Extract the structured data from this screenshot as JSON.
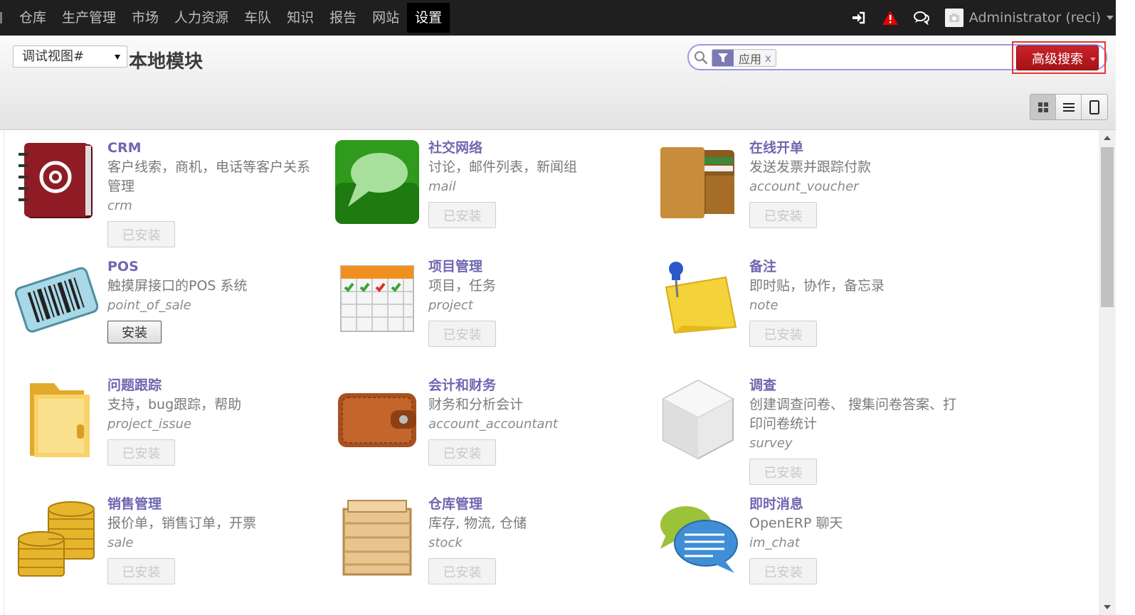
{
  "topmenu": [
    "仓库",
    "生产管理",
    "市场",
    "人力资源",
    "车队",
    "知识",
    "报告",
    "网站",
    "设置"
  ],
  "active_menu": "设置",
  "user": {
    "name": "Administrator (reci)"
  },
  "header": {
    "view_select": "调试视图#",
    "title": "本地模块",
    "facet_label": "应用",
    "facet_remove": "x",
    "search_value": "",
    "advanced_search": "高级搜索"
  },
  "view_modes": [
    "kanban-icon",
    "list-icon",
    "form-icon"
  ],
  "modules": [
    {
      "name": "CRM",
      "desc": "客户线索，商机，电话等客户关系管理",
      "tech": "crm",
      "button": "已安装",
      "installed": true,
      "icon": "address-book-icon"
    },
    {
      "name": "社交网络",
      "desc": "讨论，邮件列表，新闻组",
      "tech": "mail",
      "button": "已安装",
      "installed": true,
      "icon": "speech-bubble-icon"
    },
    {
      "name": "在线开单",
      "desc": "发送发票并跟踪付款",
      "tech": "account_voucher",
      "button": "已安装",
      "installed": true,
      "icon": "wallet-icon"
    },
    {
      "name": "POS",
      "desc": "触摸屏接口的POS 系统",
      "tech": "point_of_sale",
      "button": "安装",
      "installed": false,
      "icon": "barcode-icon"
    },
    {
      "name": "项目管理",
      "desc": "项目，任务",
      "tech": "project",
      "button": "已安装",
      "installed": true,
      "icon": "calendar-icon"
    },
    {
      "name": "备注",
      "desc": "即时贴，协作，备忘录",
      "tech": "note",
      "button": "已安装",
      "installed": true,
      "icon": "sticky-note-icon"
    },
    {
      "name": "问题跟踪",
      "desc": "支持，bug跟踪，帮助",
      "tech": "project_issue",
      "button": "已安装",
      "installed": true,
      "icon": "folder-icon"
    },
    {
      "name": "会计和财务",
      "desc": "财务和分析会计",
      "tech": "account_accountant",
      "button": "已安装",
      "installed": true,
      "icon": "purse-icon"
    },
    {
      "name": "调查",
      "desc": "创建调查问卷、 搜集问卷答案、打印问卷统计",
      "tech": "survey",
      "button": "已安装",
      "installed": true,
      "icon": "cube-icon"
    },
    {
      "name": "销售管理",
      "desc": "报价单，销售订单，开票",
      "tech": "sale",
      "button": "已安装",
      "installed": true,
      "icon": "coins-icon"
    },
    {
      "name": "仓库管理",
      "desc": "库存, 物流, 仓储",
      "tech": "stock",
      "button": "已安装",
      "installed": true,
      "icon": "crate-icon"
    },
    {
      "name": "即时消息",
      "desc": "OpenERP 聊天",
      "tech": "im_chat",
      "button": "已安装",
      "installed": true,
      "icon": "chat-bubbles-icon"
    }
  ],
  "colors": {
    "accent": "#6f67b1",
    "danger": "#c9232a",
    "topbar": "#1f1f1f"
  }
}
